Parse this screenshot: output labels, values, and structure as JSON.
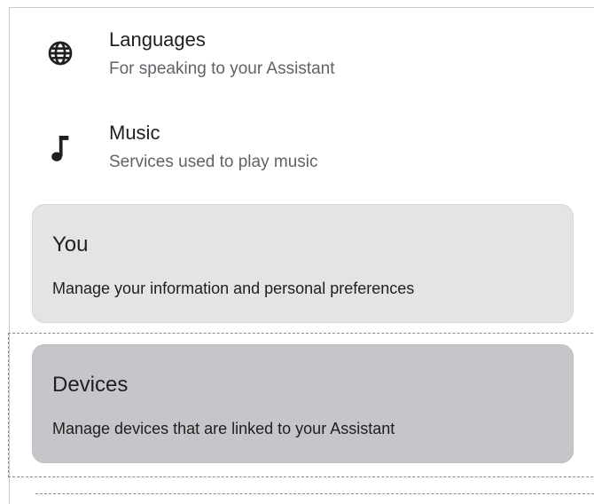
{
  "settings": {
    "items": [
      {
        "title": "Languages",
        "subtitle": "For speaking to your Assistant",
        "icon": "globe-icon"
      },
      {
        "title": "Music",
        "subtitle": "Services used to play music",
        "icon": "music-note-icon"
      }
    ]
  },
  "cards": {
    "you": {
      "title": "You",
      "description": "Manage your information and personal preferences"
    },
    "devices": {
      "title": "Devices",
      "description": "Manage devices that are linked to your Assistant"
    }
  },
  "colors": {
    "card_you_bg": "#e3e4e6",
    "card_devices_bg": "#c5c6ca",
    "subtitle_text": "#5f6368"
  }
}
